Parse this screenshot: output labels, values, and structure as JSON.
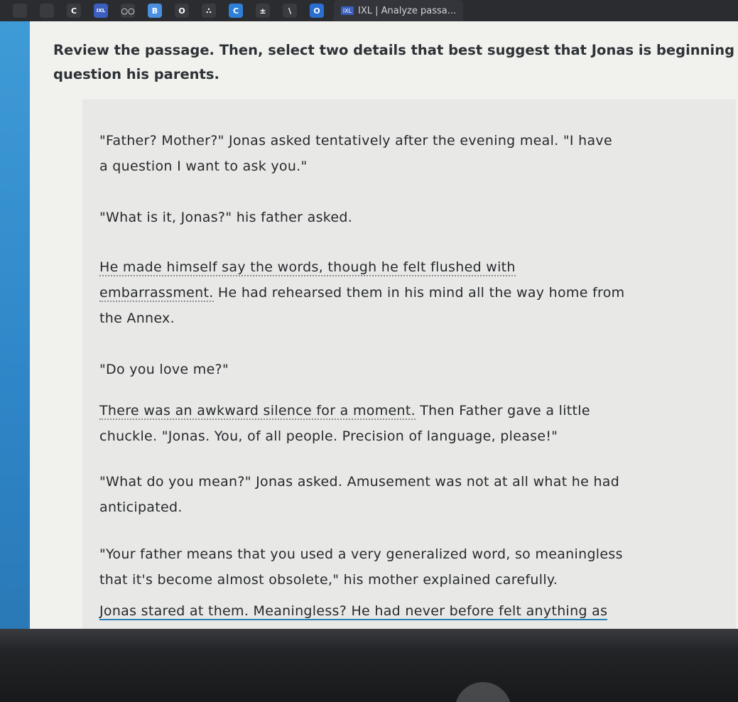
{
  "browser": {
    "tab_title": "IXL | Analyze passa...",
    "tab_favicon_text": "IXL",
    "pinned_tabs": [
      {
        "icon": "grid-icon",
        "label": "",
        "color": "#3a3b3f"
      },
      {
        "icon": "drive-icon",
        "label": "",
        "color": "#3a3b3f"
      },
      {
        "icon": "c-icon",
        "label": "C",
        "color": "#3a3b3f"
      },
      {
        "icon": "ixl-icon",
        "label": "IXL",
        "color": "#3b5fbf"
      },
      {
        "icon": "circles-icon",
        "label": "○○",
        "color": "#3a3b3f"
      },
      {
        "icon": "b-icon",
        "label": "B",
        "color": "#4a8fe0"
      },
      {
        "icon": "o-icon",
        "label": "O",
        "color": "#3a3b3f"
      },
      {
        "icon": "dots-icon",
        "label": "∴",
        "color": "#3a3b3f"
      },
      {
        "icon": "c-blue-icon",
        "label": "C",
        "color": "#2e7fd8"
      },
      {
        "icon": "plus-minus-icon",
        "label": "±",
        "color": "#3a3b3f"
      },
      {
        "icon": "slash-icon",
        "label": "\\",
        "color": "#3a3b3f"
      },
      {
        "icon": "outlook-icon",
        "label": "O",
        "color": "#2a6fd0"
      }
    ]
  },
  "question": {
    "line1": "Review the passage. Then, select two details that best suggest that Jonas is beginning to",
    "line2": "question his parents."
  },
  "passage": {
    "p1_l1": "\"Father? Mother?\" Jonas asked tentatively after the evening meal. \"I have",
    "p1_l2": "a question I want to ask you.\"",
    "p2": "\"What is it, Jonas?\" his father asked.",
    "p3_l1": "He made himself say the words, though he felt flushed with",
    "p3_l2a": "embarrassment.",
    "p3_l2b": " He had rehearsed them in his mind all the way home from",
    "p3_l3": "the Annex.",
    "p4": "\"Do you love me?\"",
    "p5_l1a": "There was an awkward silence for a moment.",
    "p5_l1b": " Then Father gave a little",
    "p5_l2": "chuckle. \"Jonas. You, of all people. Precision of language, please!\"",
    "p6_l1": "\"What do you mean?\" Jonas asked. Amusement was not at all what he had",
    "p6_l2": "anticipated.",
    "p7_l1": "\"Your father means that you used a very generalized word, so meaningless",
    "p7_l2": "that it's become almost obsolete,\" his mother explained carefully.",
    "p8_l1": "Jonas stared at them. Meaningless? He had never before felt anything as"
  }
}
